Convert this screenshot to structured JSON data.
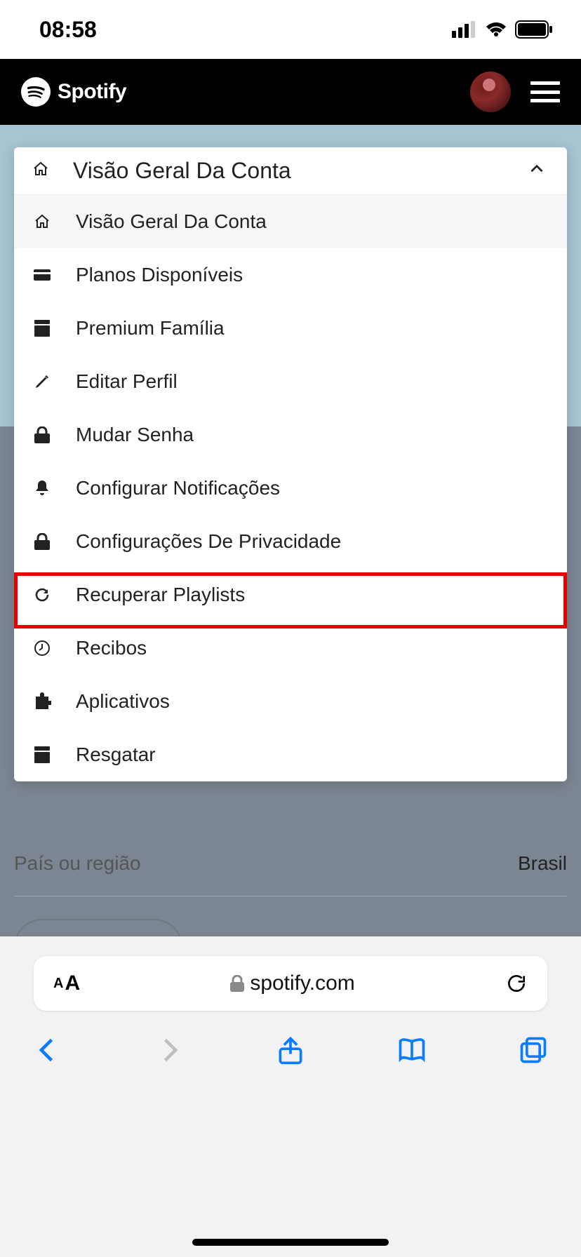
{
  "status": {
    "time": "08:58"
  },
  "brand": {
    "name": "Spotify"
  },
  "dropdown": {
    "header": "Visão Geral Da Conta",
    "items": [
      {
        "label": "Visão Geral Da Conta",
        "icon": "home"
      },
      {
        "label": "Planos Disponíveis",
        "icon": "card"
      },
      {
        "label": "Premium Família",
        "icon": "archive"
      },
      {
        "label": "Editar Perfil",
        "icon": "pencil"
      },
      {
        "label": "Mudar Senha",
        "icon": "lock"
      },
      {
        "label": "Configurar Notificações",
        "icon": "bell"
      },
      {
        "label": "Configurações De Privacidade",
        "icon": "lock"
      },
      {
        "label": "Recuperar Playlists",
        "icon": "refresh"
      },
      {
        "label": "Recibos",
        "icon": "clock"
      },
      {
        "label": "Aplicativos",
        "icon": "puzzle"
      },
      {
        "label": "Resgatar",
        "icon": "archive"
      }
    ]
  },
  "profile": {
    "country_label": "País ou região",
    "country_value": "Brasil"
  },
  "browser": {
    "domain": "spotify.com"
  }
}
